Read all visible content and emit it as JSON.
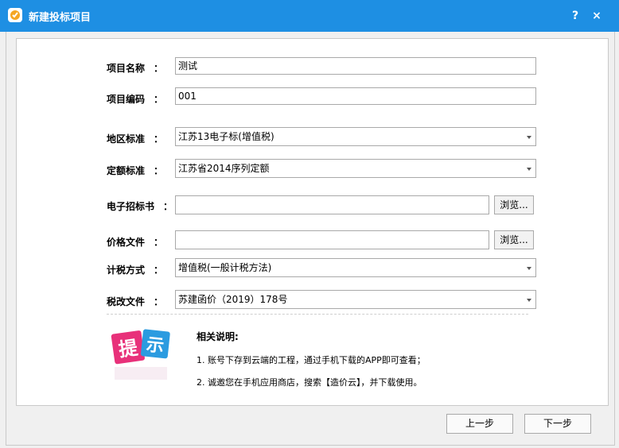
{
  "window": {
    "title": "新建投标项目",
    "help_label": "?",
    "close_label": "×"
  },
  "form": {
    "colon": "：",
    "project_name": {
      "label": "项目名称",
      "value": "测试"
    },
    "project_code": {
      "label": "项目编码",
      "value": "001"
    },
    "region_standard": {
      "label": "地区标准",
      "value": "江苏13电子标(增值税)"
    },
    "quota_standard": {
      "label": "定额标准",
      "value": "江苏省2014序列定额"
    },
    "tender_doc": {
      "label": "电子招标书",
      "value": "",
      "browse_label": "浏览..."
    },
    "price_file": {
      "label": "价格文件",
      "value": "",
      "browse_label": "浏览..."
    },
    "tax_method": {
      "label": "计税方式",
      "value": "增值税(一般计税方法)"
    },
    "tax_reform_doc": {
      "label": "税改文件",
      "value": "苏建函价（2019）178号"
    }
  },
  "tip": {
    "icon_text_1": "提",
    "icon_text_2": "示",
    "title": "相关说明:",
    "items": [
      "1. 账号下存到云端的工程，通过手机下载的APP即可查看；",
      "2. 诚邀您在手机应用商店，搜索【造价云】，并下载使用。"
    ]
  },
  "footer": {
    "prev_label": "上一步",
    "next_label": "下一步"
  }
}
